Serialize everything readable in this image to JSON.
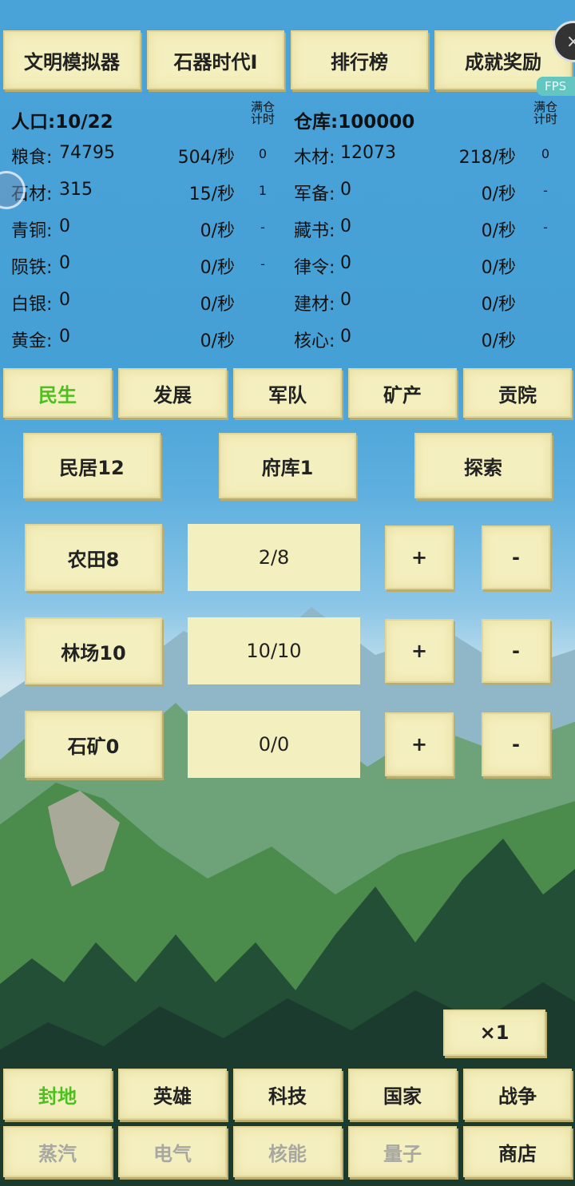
{
  "top_nav": [
    "文明模拟器",
    "石器时代Ⅰ",
    "排行榜",
    "成就奖励"
  ],
  "overlay": {
    "fps_label": "FPS"
  },
  "left_header": {
    "label": "人口:",
    "value": "10/22",
    "full_label": "满仓计时"
  },
  "right_header": {
    "label": "仓库:",
    "value": "100000",
    "full_label": "满仓计时"
  },
  "left_resources": [
    {
      "name": "粮食:",
      "amount": "74795",
      "rate": "504/秒",
      "timer": "0"
    },
    {
      "name": "石材:",
      "amount": "315",
      "rate": "15/秒",
      "timer": "1"
    },
    {
      "name": "青铜:",
      "amount": "0",
      "rate": "0/秒",
      "timer": "-"
    },
    {
      "name": "陨铁:",
      "amount": "0",
      "rate": "0/秒",
      "timer": "-"
    },
    {
      "name": "白银:",
      "amount": "0",
      "rate": "0/秒",
      "timer": ""
    },
    {
      "name": "黄金:",
      "amount": "0",
      "rate": "0/秒",
      "timer": ""
    }
  ],
  "right_resources": [
    {
      "name": "木材:",
      "amount": "12073",
      "rate": "218/秒",
      "timer": "0"
    },
    {
      "name": "军备:",
      "amount": "0",
      "rate": "0/秒",
      "timer": "-"
    },
    {
      "name": "藏书:",
      "amount": "0",
      "rate": "0/秒",
      "timer": "-"
    },
    {
      "name": "律令:",
      "amount": "0",
      "rate": "0/秒",
      "timer": ""
    },
    {
      "name": "建材:",
      "amount": "0",
      "rate": "0/秒",
      "timer": ""
    },
    {
      "name": "核心:",
      "amount": "0",
      "rate": "0/秒",
      "timer": ""
    }
  ],
  "category_tabs": [
    "民生",
    "发展",
    "军队",
    "矿产",
    "贡院"
  ],
  "active_category": "民生",
  "buildings": [
    "民居12",
    "府库1",
    "探索"
  ],
  "workers": [
    {
      "name": "农田8",
      "value": "2/8",
      "plus": "+",
      "minus": "-"
    },
    {
      "name": "林场10",
      "value": "10/10",
      "plus": "+",
      "minus": "-"
    },
    {
      "name": "石矿0",
      "value": "0/0",
      "plus": "+",
      "minus": "-"
    }
  ],
  "speed_label": "×1",
  "bottom_row1": [
    "封地",
    "英雄",
    "科技",
    "国家",
    "战争"
  ],
  "bottom_row2": [
    "蒸汽",
    "电气",
    "核能",
    "量子",
    "商店"
  ],
  "colors": {
    "button_bg": "#f4efbe",
    "active_text": "#4dbf20",
    "disabled_text": "#a8a8a0",
    "sky": "#45a0d6"
  }
}
